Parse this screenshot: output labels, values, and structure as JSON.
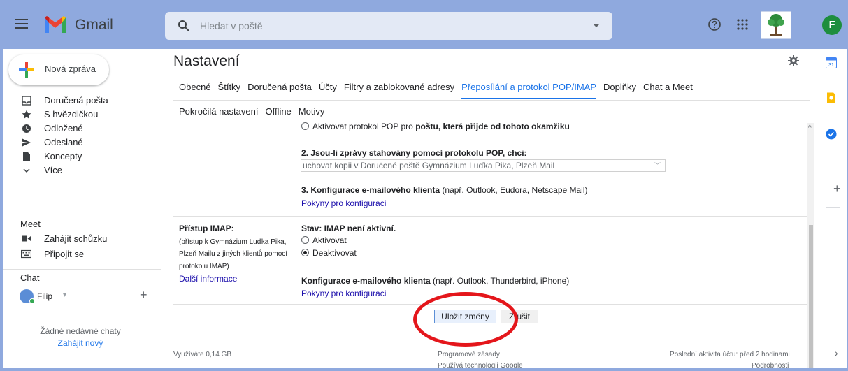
{
  "app": {
    "name": "Gmail"
  },
  "search": {
    "placeholder": "Hledat v poště"
  },
  "header": {
    "avatar_letter": "F"
  },
  "sidebar": {
    "compose_label": "Nová zpráva",
    "items": [
      {
        "label": "Doručená pošta",
        "icon": "inbox-icon"
      },
      {
        "label": "S hvězdičkou",
        "icon": "star-icon"
      },
      {
        "label": "Odložené",
        "icon": "clock-icon"
      },
      {
        "label": "Odeslané",
        "icon": "send-icon"
      },
      {
        "label": "Koncepty",
        "icon": "draft-icon"
      },
      {
        "label": "Více",
        "icon": "chevron-down-icon"
      }
    ],
    "meet": {
      "title": "Meet",
      "items": [
        {
          "label": "Zahájit schůzku",
          "icon": "video-icon"
        },
        {
          "label": "Připojit se",
          "icon": "keyboard-icon"
        }
      ]
    },
    "chat": {
      "title": "Chat",
      "user": "Filip",
      "no_chats": "Žádné nedávné chaty",
      "start_new": "Zahájit nový"
    }
  },
  "main": {
    "title": "Nastavení",
    "tabs_row1": [
      "Obecné",
      "Štítky",
      "Doručená pošta",
      "Účty",
      "Filtry a zablokované adresy",
      "Přeposílání a protokol POP/IMAP",
      "Doplňky",
      "Chat a Meet"
    ],
    "active_tab_index": 5,
    "tabs_row2": [
      "Pokročilá nastavení",
      "Offline",
      "Motivy"
    ],
    "pop": {
      "radio_prefix": "Aktivovat protokol POP pro ",
      "radio_bold": "poštu, která přijde od tohoto okamžiku",
      "q2_label": "2. Jsou-li zprávy stahovány pomocí protokolu POP, chci:",
      "q2_select_value": "uchovat kopii v Doručené poště Gymnázium Luďka Pika, Plzeň Mail",
      "q3_bold": "3. Konfigurace e-mailového klienta",
      "q3_rest": " (např. Outlook, Eudora, Netscape Mail)",
      "q3_link": "Pokyny pro konfiguraci"
    },
    "imap": {
      "label": "Přístup IMAP:",
      "desc_lines": [
        "(přístup k Gymnázium Luďka Pika,",
        "Plzeň Mailu z jiných klientů pomocí",
        "protokolu IMAP)"
      ],
      "more_info": "Další informace",
      "status": "Stav: IMAP není aktivní.",
      "options": [
        "Aktivovat",
        "Deaktivovat"
      ],
      "selected_index": 1,
      "client_bold": "Konfigurace e-mailového klienta",
      "client_rest": " (např. Outlook, Thunderbird, iPhone)",
      "client_link": "Pokyny pro konfiguraci"
    },
    "buttons": {
      "save": "Uložit změny",
      "cancel": "Zrušit"
    },
    "footer": {
      "storage": "Využíváte 0,14 GB",
      "policy": "Programové zásady",
      "powered": "Používá technologii Google",
      "activity": "Poslední aktivita účtu: před 2 hodinami",
      "details": "Podrobnosti"
    }
  },
  "right_panel": {
    "icons": [
      "calendar-icon",
      "keep-icon",
      "tasks-icon"
    ],
    "calendar_day": "31"
  },
  "colors": {
    "frame": "#8fa9de",
    "accent": "#1a73e8",
    "highlight_ellipse": "#e4161b"
  }
}
